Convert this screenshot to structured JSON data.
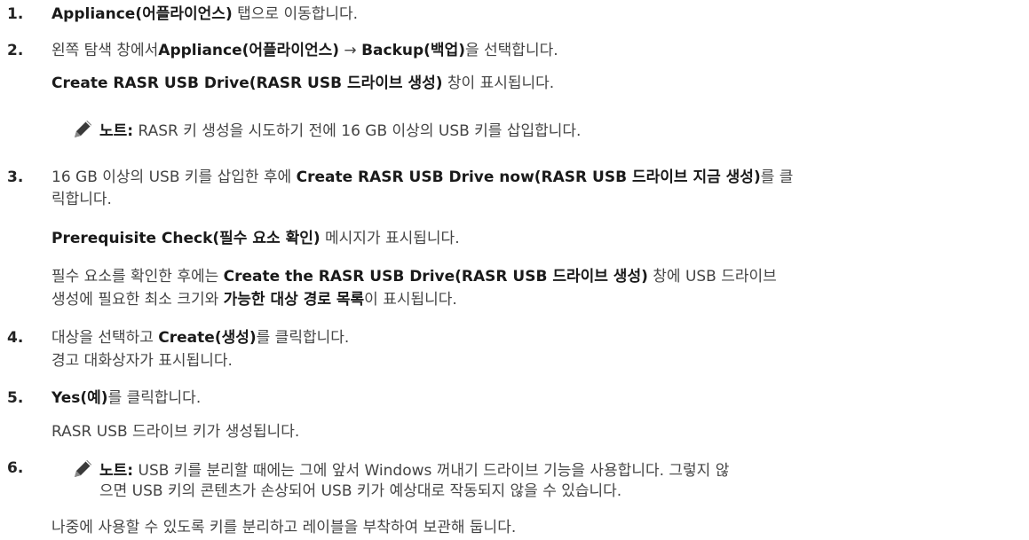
{
  "steps": [
    {
      "num": "1.",
      "segments": [
        {
          "t": "Appliance(어플라이언스)",
          "b": true
        },
        {
          "t": " 탭으로 이동합니다."
        }
      ]
    },
    {
      "num": "2.",
      "segments": [
        {
          "t": "왼쪽 탐색 창에서"
        },
        {
          "t": "Appliance(어플라이언스)",
          "b": true
        },
        {
          "t": " → "
        },
        {
          "t": "Backup(백업)",
          "b": true
        },
        {
          "t": "을 선택합니다."
        }
      ],
      "result": [
        {
          "t": "Create RASR USB Drive(RASR USB 드라이브 생성)",
          "b": true
        },
        {
          "t": " 창이 표시됩니다."
        }
      ]
    },
    {
      "num": "3.",
      "segments": [
        {
          "t": "16 GB 이상의 USB 키를 삽입한 후에 "
        },
        {
          "t": "Create RASR USB Drive now(RASR USB 드라이브 지금 생성)",
          "b": true
        },
        {
          "t": "를 클"
        }
      ],
      "cont": "릭합니다.",
      "result": [
        {
          "t": "Prerequisite Check(필수 요소 확인)",
          "b": true
        },
        {
          "t": " 메시지가 표시됩니다."
        }
      ],
      "para1": [
        {
          "t": "필수 요소를 확인한 후에는 "
        },
        {
          "t": "Create the RASR USB Drive(RASR USB 드라이브 생성)",
          "b": true
        },
        {
          "t": " 창에 USB 드라이브"
        }
      ],
      "para2": [
        {
          "t": "생성에 필요한 최소 크기와 "
        },
        {
          "t": "가능한 대상 경로 목록",
          "b": true
        },
        {
          "t": "이 표시됩니다."
        }
      ]
    },
    {
      "num": "4.",
      "segments": [
        {
          "t": "대상을 선택하고 "
        },
        {
          "t": "Create(생성)",
          "b": true
        },
        {
          "t": "를 클릭합니다."
        }
      ],
      "result_text": "경고 대화상자가 표시됩니다."
    },
    {
      "num": "5.",
      "segments": [
        {
          "t": "Yes(예)",
          "b": true
        },
        {
          "t": "를 클릭합니다."
        }
      ],
      "result_text": "RASR USB 드라이브 키가 생성됩니다."
    },
    {
      "num": "6."
    }
  ],
  "note1": {
    "label": "노트:",
    "text": " RASR 키 생성을 시도하기 전에 16 GB 이상의 USB 키를 삽입합니다."
  },
  "note2": {
    "label": "노트:",
    "text": " USB 키를 분리할 때에는 그에 앞서 Windows 꺼내기 드라이브 기능을 사용합니다. 그렇지 않",
    "text2": "으면 USB 키의 콘텐츠가 손상되어 USB 키가 예상대로 작동되지 않을 수 있습니다."
  },
  "final": "나중에 사용할 수 있도록 키를 분리하고 레이블을 부착하여 보관해 둡니다."
}
